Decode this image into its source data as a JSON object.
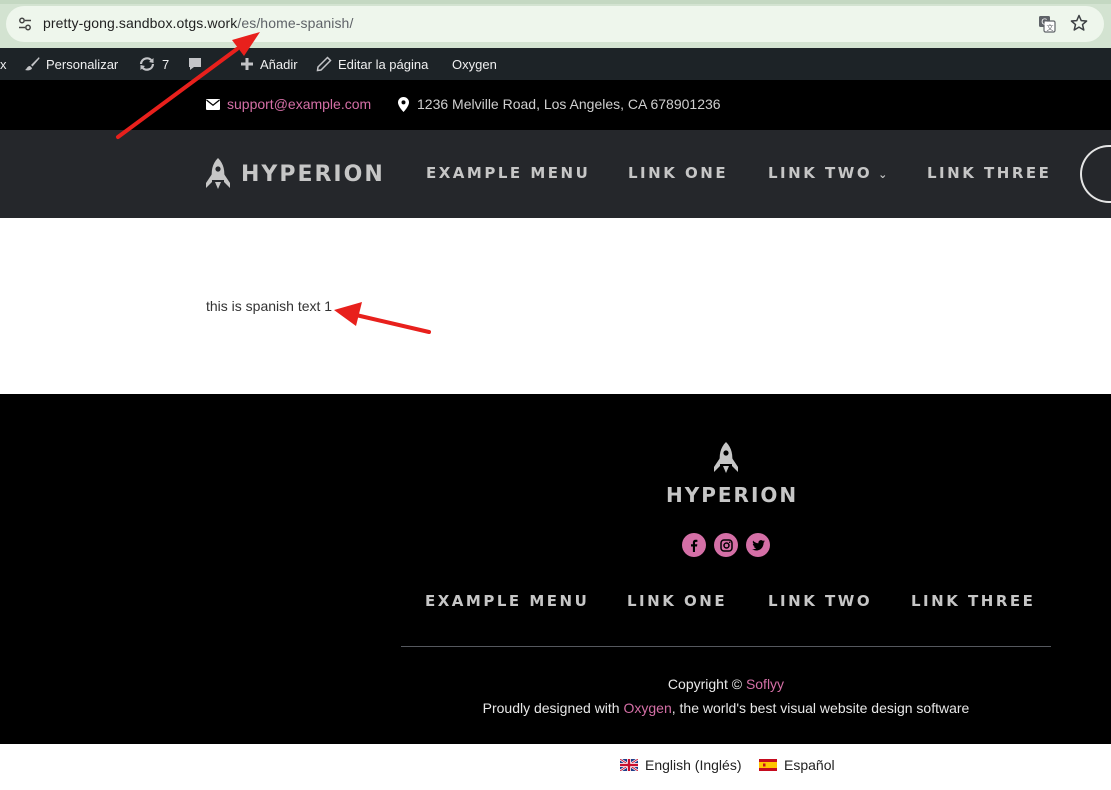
{
  "browser": {
    "url_host": "pretty-gong.sandbox.otgs.work",
    "url_path": "/es/home-spanish/"
  },
  "admin_bar": {
    "partial_item": "x",
    "customize_label": "Personalizar",
    "updates_count": "7",
    "add_label": "Añadir",
    "edit_label": "Editar la página",
    "oxygen_label": "Oxygen"
  },
  "top_info": {
    "email": "support@example.com",
    "address": "1236 Melville Road, Los Angeles, CA 678901236"
  },
  "header": {
    "logo_text": "HYPERION",
    "nav": [
      {
        "label": "EXAMPLE MENU"
      },
      {
        "label": "LINK ONE"
      },
      {
        "label": "LINK TWO"
      },
      {
        "label": "LINK THREE"
      }
    ]
  },
  "content": {
    "text": "this  is spanish text 1"
  },
  "footer": {
    "logo_text": "HYPERION",
    "nav": [
      {
        "label": "EXAMPLE MENU"
      },
      {
        "label": "LINK ONE"
      },
      {
        "label": "LINK TWO"
      },
      {
        "label": "LINK THREE"
      }
    ],
    "copyright_prefix": "Copyright © ",
    "copyright_link": "Soflyy",
    "designed_prefix": "Proudly designed with ",
    "designed_link": "Oxygen",
    "designed_suffix": ", the world's best visual website design software"
  },
  "languages": [
    {
      "label": "English (Inglés)"
    },
    {
      "label": "Español"
    }
  ],
  "colors": {
    "accent": "#d46fa6",
    "header_bg": "#25272b",
    "annotation": "#e8201c"
  }
}
